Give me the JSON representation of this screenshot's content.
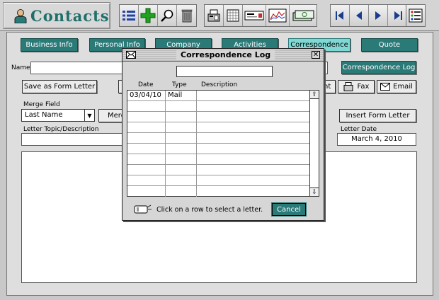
{
  "app": {
    "title": "Contacts"
  },
  "tabs": [
    {
      "label": "Business Info"
    },
    {
      "label": "Personal Info"
    },
    {
      "label": "Company"
    },
    {
      "label": "Activities"
    },
    {
      "label": "Correspondence"
    },
    {
      "label": "Quote"
    }
  ],
  "form": {
    "name_label": "Name",
    "name_value": "",
    "correspondence_log_button": "Correspondence Log",
    "save_form_letter_button": "Save as Form Letter",
    "print_button_partial": "nt",
    "fax_button": "Fax",
    "email_button": "Email",
    "merge_field_label": "Merge Field",
    "merge_field_value": "Last Name",
    "merge_button_partial": "Merg",
    "insert_form_letter_button": "Insert Form Letter",
    "letter_topic_label": "Letter Topic/Description",
    "letter_topic_value": "",
    "letter_date_label": "Letter Date",
    "letter_date_value": "March 4, 2010",
    "letter_body": ""
  },
  "dialog": {
    "title": "Correspondence Log",
    "search_value": "",
    "columns": [
      "Date",
      "Type",
      "Description"
    ],
    "rows": [
      {
        "date": "03/04/10",
        "type": "Mail",
        "description": ""
      }
    ],
    "empty_rows": 9,
    "hint": "Click on a row to select a letter.",
    "cancel_button": "Cancel"
  },
  "colors": {
    "accent": "#2a7a78",
    "active_tab": "#7fd8d4",
    "title": "#1f6f6b"
  },
  "icons": [
    "person-icon",
    "list-icon",
    "add-icon",
    "search-icon",
    "trash-icon",
    "fax-icon",
    "calendar-icon",
    "card-icon",
    "chart-icon",
    "money-icon",
    "first-record-icon",
    "prev-record-icon",
    "next-record-icon",
    "last-record-icon",
    "menu-list-icon"
  ]
}
